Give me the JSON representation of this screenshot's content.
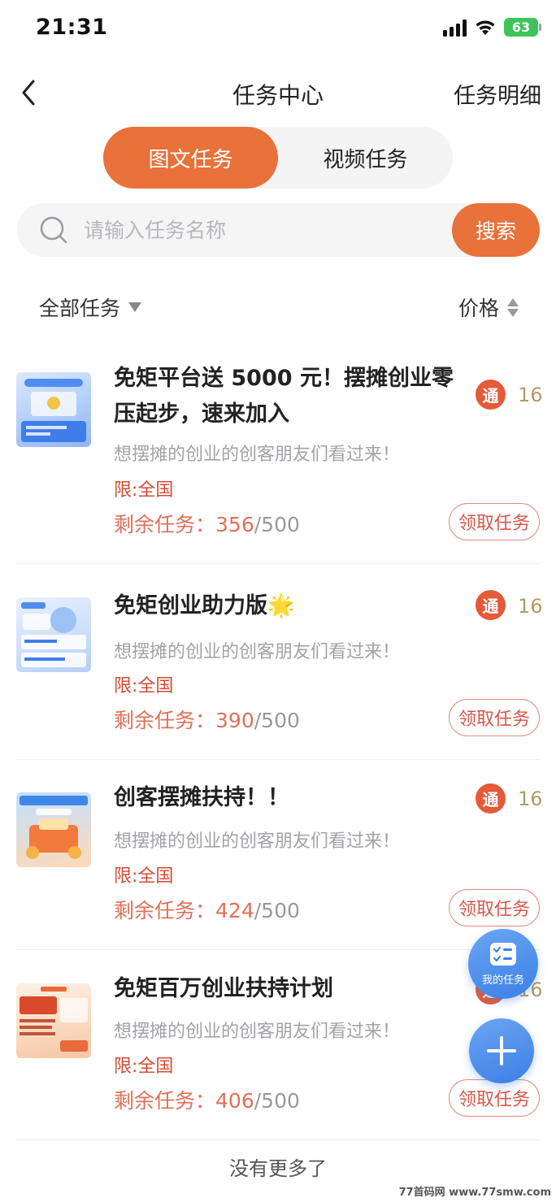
{
  "status": {
    "time": "21:31",
    "battery": "63"
  },
  "nav": {
    "title": "任务中心",
    "right_link": "任务明细"
  },
  "tabs": [
    {
      "label": "图文任务",
      "active": true
    },
    {
      "label": "视频任务",
      "active": false
    }
  ],
  "search": {
    "placeholder": "请输入任务名称",
    "value": "",
    "button": "搜索"
  },
  "filter": {
    "all_tasks": "全部任务",
    "price": "价格"
  },
  "tasks": [
    {
      "title": "免矩平台送 5000 元！摆摊创业零压起步，速来加入",
      "badge": "通",
      "reward": "16",
      "desc": "想摆摊的创业的创客朋友们看过来！",
      "limit": "限:全国",
      "remain_label": "剩余任务：",
      "remain": "356",
      "total": "/500",
      "claim": "领取任务"
    },
    {
      "title": "免矩创业助力版🌟",
      "badge": "通",
      "reward": "16",
      "desc": "想摆摊的创业的创客朋友们看过来！",
      "limit": "限:全国",
      "remain_label": "剩余任务：",
      "remain": "390",
      "total": "/500",
      "claim": "领取任务"
    },
    {
      "title": "创客摆摊扶持！！",
      "badge": "通",
      "reward": "16",
      "desc": "想摆摊的创业的创客朋友们看过来！",
      "limit": "限:全国",
      "remain_label": "剩余任务：",
      "remain": "424",
      "total": "/500",
      "claim": "领取任务"
    },
    {
      "title": "免矩百万创业扶持计划",
      "badge": "通",
      "reward": "16",
      "desc": "想摆摊的创业的创客朋友们看过来！",
      "limit": "限:全国",
      "remain_label": "剩余任务：",
      "remain": "406",
      "total": "/500",
      "claim": "领取任务"
    }
  ],
  "fab": {
    "my_tasks": "我的任务"
  },
  "footer": {
    "no_more": "没有更多了"
  },
  "watermark": "77首码网 www.77smw.com",
  "colors": {
    "accent": "#e9713a",
    "fab_blue": "#3c7fe6",
    "badge_red": "#e55a39"
  }
}
